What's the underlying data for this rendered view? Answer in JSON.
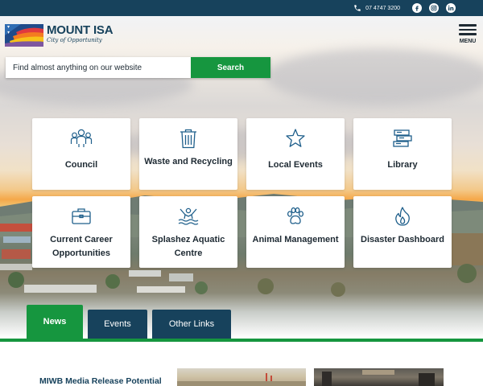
{
  "topbar": {
    "phone": "07 4747 3200",
    "social": [
      {
        "icon": "facebook-icon",
        "glyph": "f"
      },
      {
        "icon": "instagram-icon",
        "glyph": ""
      },
      {
        "icon": "linkedin-icon",
        "glyph": "in"
      }
    ]
  },
  "logo": {
    "title": "MOUNT ISA",
    "tagline": "City of Opportunity"
  },
  "menu": {
    "label": "MENU"
  },
  "search": {
    "placeholder": "Find almost anything on our website",
    "button": "Search"
  },
  "tiles": [
    {
      "label": "Council",
      "icon": "people-icon"
    },
    {
      "label": "Waste and Recycling",
      "icon": "bin-icon"
    },
    {
      "label": "Local Events",
      "icon": "star-icon"
    },
    {
      "label": "Library",
      "icon": "books-icon"
    },
    {
      "label": "Current Career Opportunities",
      "icon": "briefcase-icon"
    },
    {
      "label": "Splashez Aquatic Centre",
      "icon": "swimmer-icon"
    },
    {
      "label": "Animal Management",
      "icon": "paw-icon"
    },
    {
      "label": "Disaster Dashboard",
      "icon": "flame-icon"
    }
  ],
  "tabs": [
    {
      "label": "News",
      "active": true
    },
    {
      "label": "Events",
      "active": false
    },
    {
      "label": "Other Links",
      "active": false
    }
  ],
  "news": {
    "first_title": "MIWB Media Release Potential"
  },
  "colors": {
    "navy": "#17425c",
    "green": "#16963f",
    "icon_blue": "#1f5f8b"
  }
}
